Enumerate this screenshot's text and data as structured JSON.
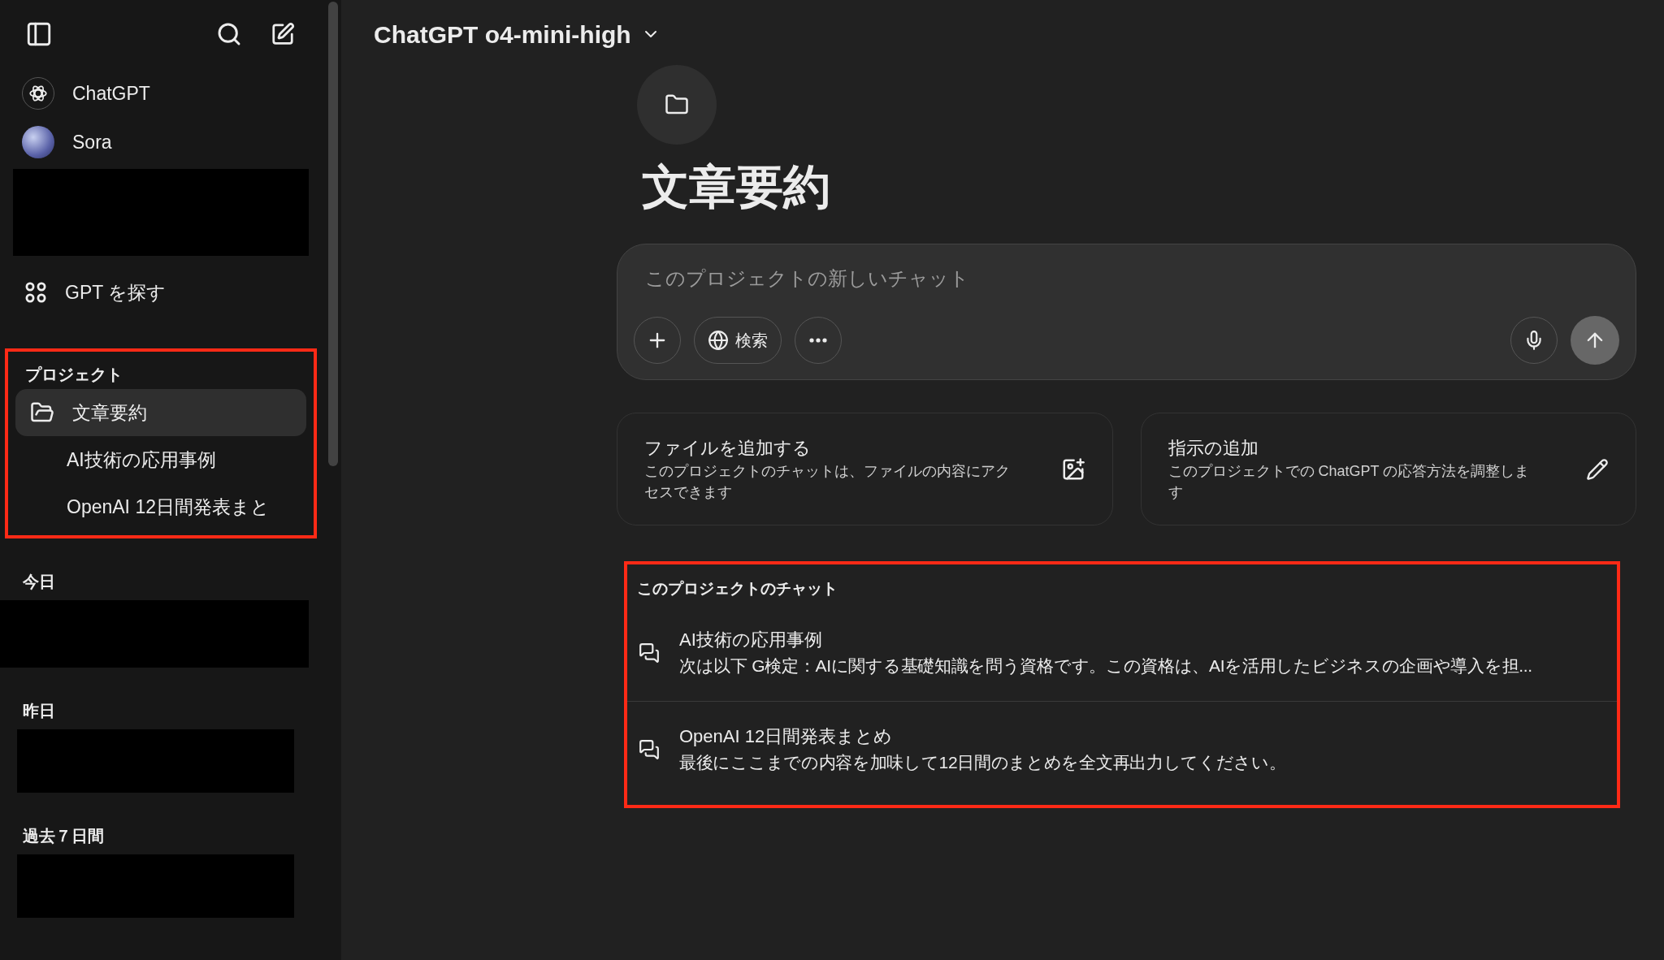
{
  "sidebar": {
    "top_items": [
      {
        "label": "ChatGPT",
        "kind": "chatgpt"
      },
      {
        "label": "Sora",
        "kind": "sora"
      }
    ],
    "explore": {
      "label": "GPT を探す"
    },
    "projects": {
      "heading": "プロジェクト",
      "items": [
        {
          "label": "文章要約",
          "selected": true,
          "kind": "project"
        },
        {
          "label": "AI技術の応用事例",
          "selected": false,
          "kind": "chat"
        },
        {
          "label": "OpenAI 12日間発表まと",
          "selected": false,
          "kind": "chat"
        }
      ]
    },
    "history": [
      {
        "heading": "今日"
      },
      {
        "heading": "昨日"
      },
      {
        "heading": "過去７日間"
      }
    ]
  },
  "header": {
    "model": "ChatGPT o4-mini-high"
  },
  "project": {
    "title": "文章要約"
  },
  "composer": {
    "placeholder": "このプロジェクトの新しいチャット",
    "search_label": "検索"
  },
  "cards": [
    {
      "title": "ファイルを追加する",
      "description": "このプロジェクトのチャットは、ファイルの内容にアクセスできます",
      "kind": "file"
    },
    {
      "title": "指示の追加",
      "description": "このプロジェクトでの ChatGPT の応答方法を調整します",
      "kind": "instructions"
    }
  ],
  "chats": {
    "heading": "このプロジェクトのチャット",
    "items": [
      {
        "title": "AI技術の応用事例",
        "preview": "次は以下 G検定：AIに関する基礎知識を問う資格です。この資格は、AIを活用したビジネスの企画や導入を担..."
      },
      {
        "title": "OpenAI 12日間発表まとめ",
        "preview": "最後にここまでの内容を加味して12日間のまとめを全文再出力してください。"
      }
    ]
  }
}
